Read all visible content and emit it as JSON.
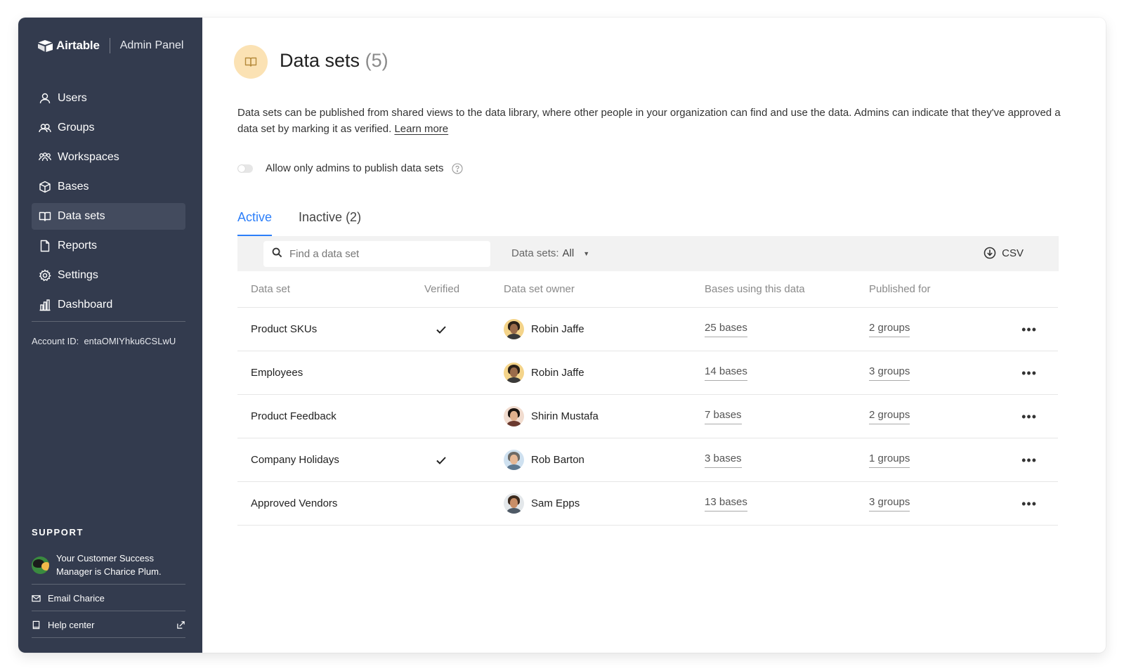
{
  "sidebar": {
    "brand": "Airtable",
    "panel_label": "Admin Panel",
    "items": [
      {
        "label": "Users",
        "icon": "user-icon"
      },
      {
        "label": "Groups",
        "icon": "group-icon"
      },
      {
        "label": "Workspaces",
        "icon": "workspaces-icon"
      },
      {
        "label": "Bases",
        "icon": "cube-icon"
      },
      {
        "label": "Data sets",
        "icon": "book-icon",
        "active": true
      },
      {
        "label": "Reports",
        "icon": "file-icon"
      },
      {
        "label": "Settings",
        "icon": "gear-icon"
      },
      {
        "label": "Dashboard",
        "icon": "bar-chart-icon"
      }
    ],
    "account_label": "Account ID:",
    "account_id": "entaOMIYhku6CSLwU",
    "support_title": "SUPPORT",
    "csm_text": "Your Customer Success Manager is Charice Plum.",
    "email_label": "Email Charice",
    "help_label": "Help center"
  },
  "page": {
    "title": "Data sets",
    "count": "(5)",
    "description": "Data sets can be published from shared views to the data library, where other people in your organization can find and use the data. Admins can indicate that they've approved a data set by marking it as verified.",
    "learn_more": "Learn more",
    "toggle_label": "Allow only admins to publish data sets",
    "toggle_on": false
  },
  "tabs": [
    {
      "label": "Active",
      "active": true
    },
    {
      "label": "Inactive (2)",
      "active": false
    }
  ],
  "toolbar": {
    "search_placeholder": "Find a data set",
    "filter_label": "Data sets:",
    "filter_value": "All",
    "csv_label": "CSV"
  },
  "table": {
    "columns": [
      "Data set",
      "Verified",
      "Data set owner",
      "Bases using this data",
      "Published for"
    ],
    "rows": [
      {
        "name": "Product SKUs",
        "verified": true,
        "owner": "Robin Jaffe",
        "bases": "25 bases",
        "published": "2 groups"
      },
      {
        "name": "Employees",
        "verified": false,
        "owner": "Robin Jaffe",
        "bases": "14 bases",
        "published": "3 groups"
      },
      {
        "name": "Product Feedback",
        "verified": false,
        "owner": "Shirin Mustafa",
        "bases": "7 bases",
        "published": "2 groups"
      },
      {
        "name": "Company Holidays",
        "verified": true,
        "owner": "Rob Barton",
        "bases": "3 bases",
        "published": "1 groups"
      },
      {
        "name": "Approved Vendors",
        "verified": false,
        "owner": "Sam Epps",
        "bases": "13 bases",
        "published": "3 groups"
      }
    ]
  },
  "colors": {
    "sidebar_bg": "#333b4e",
    "accent": "#2d7ff9",
    "badge_bg": "#fbe2b4"
  }
}
